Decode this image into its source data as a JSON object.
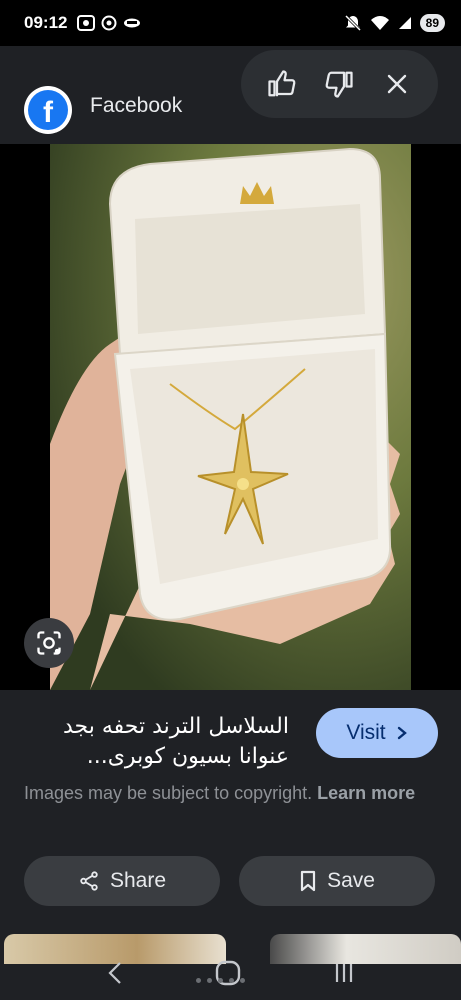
{
  "status_bar": {
    "time": "09:12",
    "battery": "89",
    "left_icons": [
      "screenshot-icon",
      "location-icon",
      "mask-icon"
    ],
    "right_icons": [
      "mute-icon",
      "wifi-icon",
      "signal-icon"
    ]
  },
  "header": {
    "source_logo_letter": "f",
    "source_name": "Facebook",
    "feedback": [
      "thumbs-up-icon",
      "thumbs-down-icon",
      "close-icon"
    ]
  },
  "image": {
    "description_icon": "lens-icon"
  },
  "info": {
    "title": "السلاسل الترند تحفه بجد عنوانا بسيون كوبرى...",
    "visit_label": "Visit",
    "copyright_text": "Images may be subject to copyright. ",
    "learn_more": "Learn more"
  },
  "actions": {
    "share_label": "Share",
    "save_label": "Save"
  },
  "colors": {
    "background": "#1f2125",
    "visit_button": "#a8c7fa",
    "facebook_blue": "#1877f2"
  }
}
